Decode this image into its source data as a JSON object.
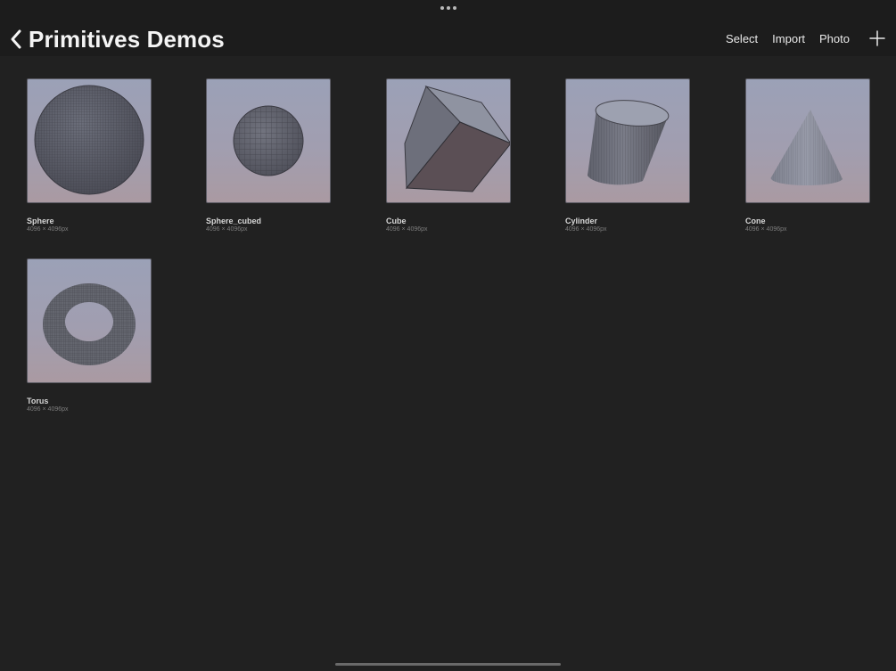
{
  "header": {
    "title": "Primitives Demos",
    "back_icon": "chevron-left-icon",
    "actions": {
      "select": "Select",
      "import": "Import",
      "photo": "Photo",
      "add_icon": "plus-icon"
    }
  },
  "gallery": {
    "items": [
      {
        "name": "Sphere",
        "size": "4096 × 4096px",
        "shape": "sphere"
      },
      {
        "name": "Sphere_cubed",
        "size": "4096 × 4096px",
        "shape": "sphere"
      },
      {
        "name": "Cube",
        "size": "4096 × 4096px",
        "shape": "cube"
      },
      {
        "name": "Cylinder",
        "size": "4096 × 4096px",
        "shape": "cylinder"
      },
      {
        "name": "Cone",
        "size": "4096 × 4096px",
        "shape": "cone"
      },
      {
        "name": "Torus",
        "size": "4096 × 4096px",
        "shape": "torus"
      }
    ]
  },
  "colors": {
    "background": "#212121",
    "top_bar": "#1c1c1c",
    "text": "#f4f4f4",
    "subtext": "#7d7d7d"
  }
}
